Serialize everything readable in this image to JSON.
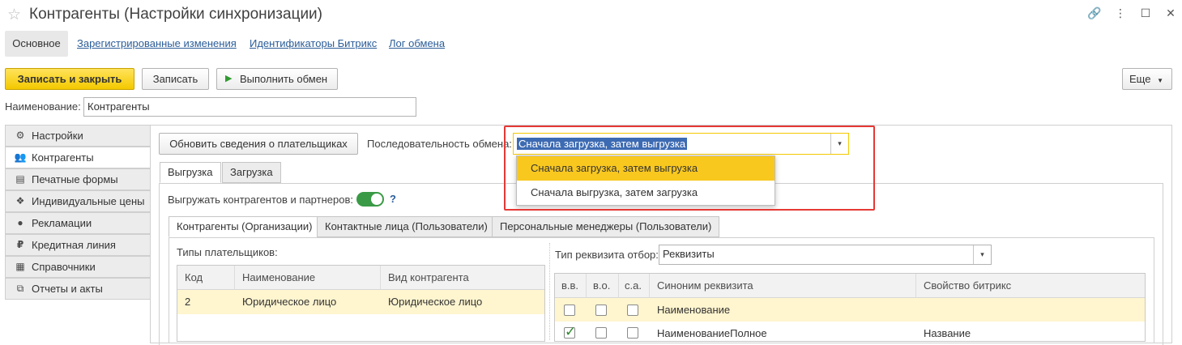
{
  "window": {
    "title": "Контрагенты (Настройки синхронизации)",
    "controls": [
      "link-icon",
      "more-icon",
      "maximize-icon",
      "close-icon"
    ]
  },
  "nav_tabs": {
    "main": "Основное",
    "links": [
      "Зарегистрированные изменения",
      "Идентификаторы Битрикс",
      "Лог обмена"
    ]
  },
  "toolbar": {
    "save_close": "Записать и закрыть",
    "save": "Записать",
    "run_exchange": "Выполнить обмен",
    "more": "Еще"
  },
  "name_field": {
    "label": "Наименование:",
    "value": "Контрагенты"
  },
  "sidebar": {
    "items": [
      {
        "label": "Настройки",
        "icon": "gear-icon"
      },
      {
        "label": "Контрагенты",
        "icon": "people-icon"
      },
      {
        "label": "Печатные формы",
        "icon": "document-icon"
      },
      {
        "label": "Индивидуальные цены",
        "icon": "handshake-icon"
      },
      {
        "label": "Рекламации",
        "icon": "user-icon"
      },
      {
        "label": "Кредитная линия",
        "icon": "ruble-icon"
      },
      {
        "label": "Справочники",
        "icon": "table-icon"
      },
      {
        "label": "Отчеты и акты",
        "icon": "report-icon"
      }
    ],
    "active_index": 1
  },
  "content": {
    "refresh_button": "Обновить сведения о плательщиках",
    "sequence_label": "Последовательность обмена:",
    "sequence_value": "Сначала загрузка, затем выгрузка",
    "dropdown_options": [
      "Сначала загрузка, затем выгрузка",
      "Сначала выгрузка, затем загрузка"
    ],
    "dropdown_selected_index": 0,
    "direction_tabs": [
      "Выгрузка",
      "Загрузка"
    ],
    "export_toggle_label": "Выгружать контрагентов и партнеров:",
    "export_toggle_on": true,
    "help": "?",
    "entity_tabs": [
      "Контрагенты (Организации)",
      "Контактные лица (Пользователи)",
      "Персональные менеджеры (Пользователи)"
    ],
    "payer_types_label": "Типы плательщиков:",
    "payer_table": {
      "columns": [
        "Код",
        "Наименование",
        "Вид контрагента"
      ],
      "rows": [
        [
          "2",
          "Юридическое лицо",
          "Юридическое лицо"
        ]
      ]
    },
    "filter_label": "Тип реквизита отбор:",
    "filter_value": "Реквизиты",
    "props_table": {
      "columns": [
        "в.в.",
        "в.о.",
        "с.а.",
        "Синоним реквизита",
        "Свойство битрикс"
      ],
      "rows": [
        {
          "vv": false,
          "vo": false,
          "sa": false,
          "synonym": "Наименование",
          "bitrix": ""
        },
        {
          "vv": true,
          "vo": false,
          "sa": false,
          "synonym": "НаименованиеПолное",
          "bitrix": "Название"
        }
      ]
    }
  },
  "colors": {
    "accent_yellow": "#f4c900",
    "selection_row": "#fff5cf",
    "highlight_box": "#e53935",
    "link": "#2b5d99",
    "toggle_green": "#3a9a46"
  }
}
